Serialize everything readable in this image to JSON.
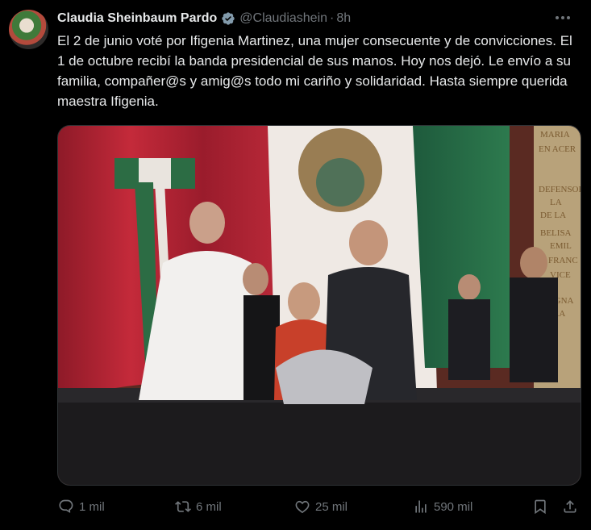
{
  "post": {
    "author_name": "Claudia Sheinbaum Pardo",
    "handle": "@Claudiashein",
    "separator": "·",
    "time": "8h",
    "text": "El 2 de junio voté por Ifigenia Martinez, una mujer consecuente y de convicciones. El 1 de octubre recibí la banda presidencial de sus manos. Hoy nos dejó. Le envío a su familia, compañer@s y amig@s todo mi cariño y solidaridad. Hasta siempre querida maestra Ifigenia.",
    "media": {
      "wall_inscription": [
        "MARIA",
        "EN ACER",
        "DEFENSOR",
        "LA",
        "DE LA",
        "BELISA",
        "EMIL",
        "FRANC",
        "VICE",
        "IGNA",
        "RA"
      ]
    }
  },
  "actions": {
    "reply_count": "1 mil",
    "repost_count": "6 mil",
    "like_count": "25 mil",
    "view_count": "590 mil"
  },
  "icons": {
    "more": "more-icon",
    "verified": "verified-badge-icon",
    "reply": "reply-icon",
    "repost": "repost-icon",
    "like": "like-icon",
    "views": "views-icon",
    "bookmark": "bookmark-icon",
    "share": "share-icon"
  },
  "colors": {
    "background": "#000000",
    "text": "#e7e9ea",
    "secondary": "#71767b",
    "verified": "#829aab"
  }
}
